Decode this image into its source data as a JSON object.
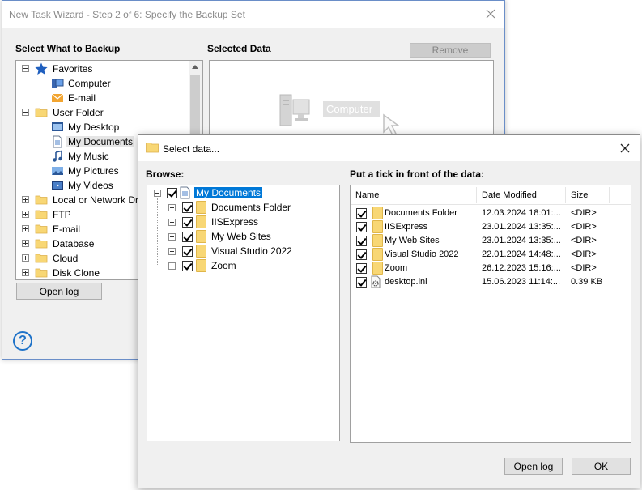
{
  "wizard": {
    "title": "New Task Wizard - Step 2 of 6: Specify the Backup Set",
    "select_label": "Select What to Backup",
    "selected_label": "Selected Data",
    "remove_label": "Remove",
    "placeholder_label": "Computer",
    "open_log_label": "Open log",
    "help_label": "?",
    "tree": [
      {
        "label": "Favorites",
        "icon": "star-icon",
        "expander": "minus"
      },
      {
        "label": "Computer",
        "icon": "computer-icon"
      },
      {
        "label": "E-mail",
        "icon": "email-icon"
      },
      {
        "label": "User Folder",
        "icon": "folder-icon",
        "expander": "minus"
      },
      {
        "label": "My Desktop",
        "icon": "desktop-icon"
      },
      {
        "label": "My Documents",
        "icon": "documents-icon",
        "selected": true
      },
      {
        "label": "My Music",
        "icon": "music-icon"
      },
      {
        "label": "My Pictures",
        "icon": "pictures-icon"
      },
      {
        "label": "My Videos",
        "icon": "videos-icon"
      },
      {
        "label": "Local or Network Dri",
        "icon": "folder-icon",
        "expander": "plus"
      },
      {
        "label": "FTP",
        "icon": "folder-icon",
        "expander": "plus"
      },
      {
        "label": "E-mail",
        "icon": "folder-icon",
        "expander": "plus"
      },
      {
        "label": "Database",
        "icon": "folder-icon",
        "expander": "plus"
      },
      {
        "label": "Cloud",
        "icon": "folder-icon",
        "expander": "plus"
      },
      {
        "label": "Disk Clone",
        "icon": "folder-icon",
        "expander": "plus"
      }
    ]
  },
  "dialog": {
    "title": "Select data...",
    "browse_label": "Browse:",
    "tick_label": "Put a tick in front of the data:",
    "open_log_label": "Open log",
    "ok_label": "OK",
    "browse_tree": {
      "root": "My Documents",
      "children": [
        "Documents Folder",
        "IISExpress",
        "My Web Sites",
        "Visual Studio 2022",
        "Zoom"
      ]
    },
    "columns": [
      "Name",
      "Date Modified",
      "Size"
    ],
    "rows": [
      {
        "name": "Documents Folder",
        "date": "12.03.2024 18:01:...",
        "size": "<DIR>",
        "icon": "folder-icon"
      },
      {
        "name": "IISExpress",
        "date": "23.01.2024 13:35:...",
        "size": "<DIR>",
        "icon": "folder-icon"
      },
      {
        "name": "My Web Sites",
        "date": "23.01.2024 13:35:...",
        "size": "<DIR>",
        "icon": "folder-icon"
      },
      {
        "name": "Visual Studio 2022",
        "date": "22.01.2024 14:48:...",
        "size": "<DIR>",
        "icon": "folder-icon"
      },
      {
        "name": "Zoom",
        "date": "26.12.2023 15:16:...",
        "size": "<DIR>",
        "icon": "folder-icon"
      },
      {
        "name": "desktop.ini",
        "date": "15.06.2023 11:14:...",
        "size": "0.39 KB",
        "icon": "settings-file-icon"
      }
    ]
  }
}
